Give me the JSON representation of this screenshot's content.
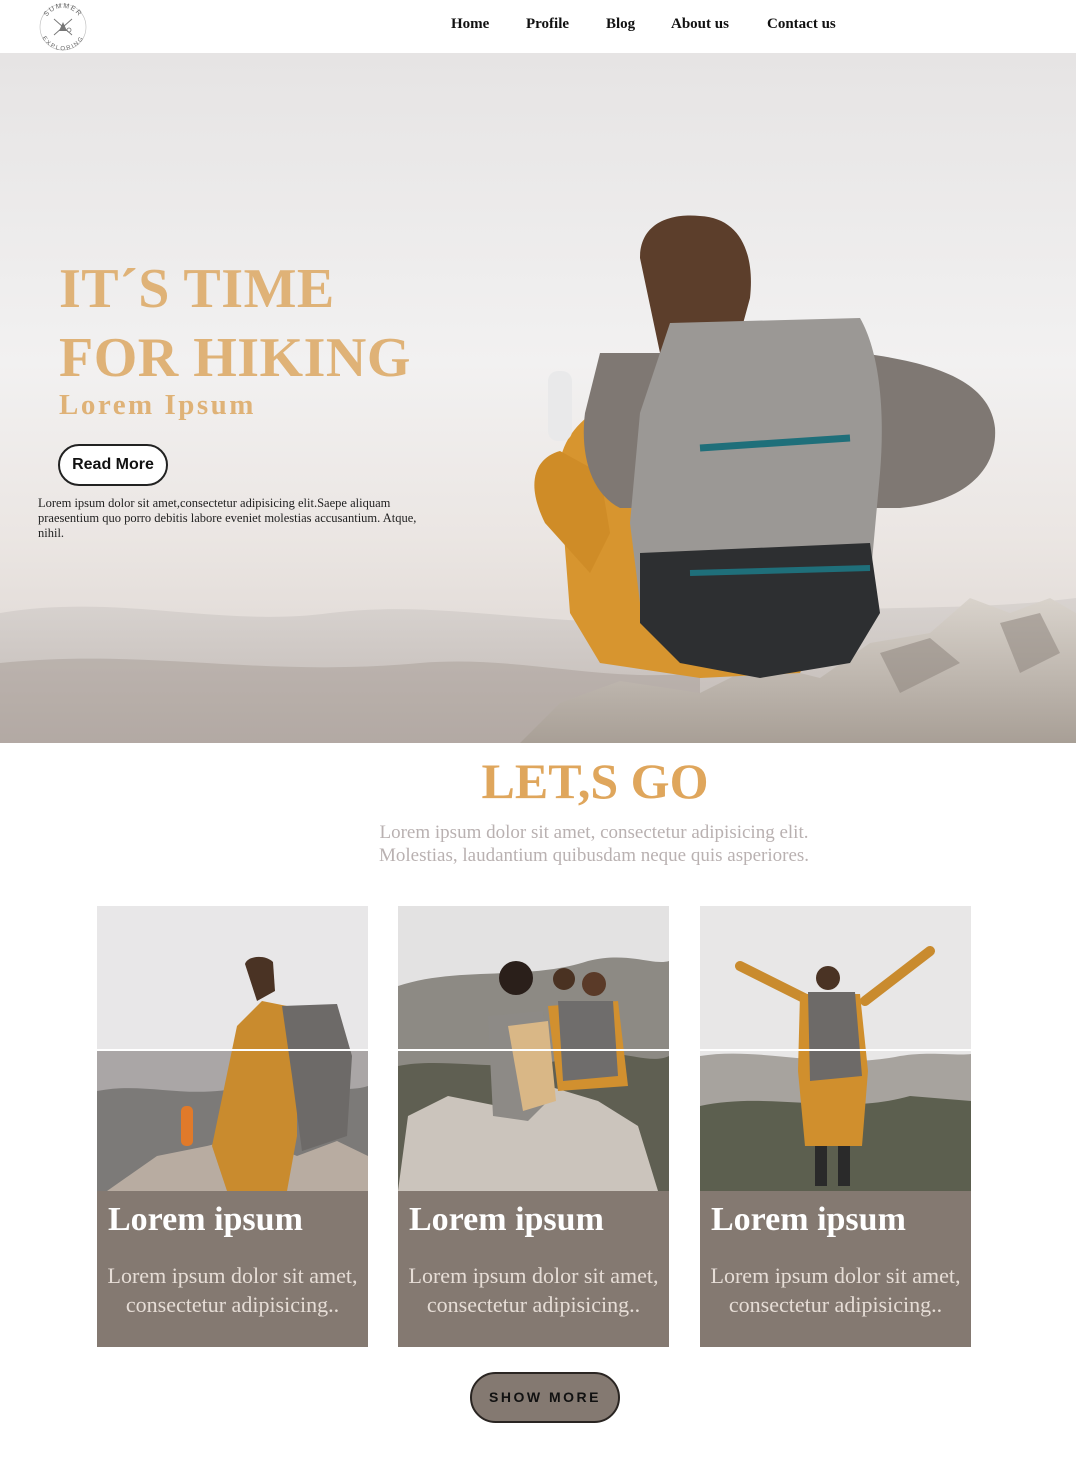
{
  "header": {
    "logo_text_top": "SUMMER",
    "logo_text_bottom": "EXPLORING",
    "nav": [
      "Home",
      "Profile",
      "Blog",
      "About us",
      "Contact us"
    ]
  },
  "hero": {
    "title_line1": "IT´S TIME",
    "title_line2": "FOR HIKING",
    "subtitle": "Lorem Ipsum",
    "button": "Read More",
    "paragraph": "Lorem ipsum dolor sit amet,consectetur adipisicing elit.Saepe aliquam praesentium quo porro debitis labore eveniet molestias accusantium. Atque, nihil."
  },
  "section": {
    "title": "LET,S GO",
    "paragraph": "Lorem ipsum dolor sit amet, consectetur adipisicing elit. Molestias, laudantium quibusdam neque quis asperiores."
  },
  "cards": [
    {
      "title": "Lorem ipsum",
      "text": "Lorem ipsum dolor sit amet, consectetur adipisicing.."
    },
    {
      "title": "Lorem ipsum",
      "text": "Lorem ipsum dolor sit amet, consectetur adipisicing.."
    },
    {
      "title": "Lorem ipsum",
      "text": "Lorem ipsum dolor sit amet, consectetur adipisicing.."
    }
  ],
  "show_more": "SHOW MORE",
  "colors": {
    "accent_gold": "#dfb277",
    "card_bg": "#847971",
    "muted_text": "#b9b1b1"
  }
}
